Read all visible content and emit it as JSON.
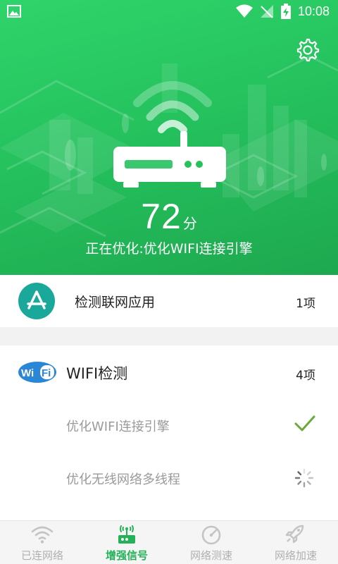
{
  "status_bar": {
    "time": "10:08",
    "icons": [
      "image-icon",
      "wifi-icon",
      "no-signal-icon",
      "battery-charging-icon"
    ]
  },
  "header": {
    "settings_icon": "gear-icon",
    "score": "72",
    "score_unit": "分",
    "status_text": "正在优化:优化WIFI连接引擎"
  },
  "app_detect": {
    "title": "检测联网应用",
    "count": "1项",
    "icon": "app-store-icon"
  },
  "wifi_detect": {
    "logo_text": "WiFi",
    "title": "WIFI检测",
    "count": "4项",
    "items": [
      {
        "label": "优化WIFI连接引擎",
        "state": "done",
        "icon": "check-icon"
      },
      {
        "label": "优化无线网络多线程",
        "state": "loading",
        "icon": "spinner-icon"
      }
    ]
  },
  "bottom_nav": {
    "items": [
      {
        "label": "已连网络",
        "icon": "wifi-icon",
        "active": false
      },
      {
        "label": "增强信号",
        "icon": "signal-router-icon",
        "active": true
      },
      {
        "label": "网络测速",
        "icon": "speedometer-icon",
        "active": false
      },
      {
        "label": "网络加速",
        "icon": "rocket-icon",
        "active": false
      }
    ]
  },
  "colors": {
    "brand_green": "#25c25e",
    "active_tab": "#23b257",
    "check_green": "#6aaa3a",
    "app_icon_teal": "#1aa89a",
    "wifi_logo_blue": "#2a86d6"
  }
}
